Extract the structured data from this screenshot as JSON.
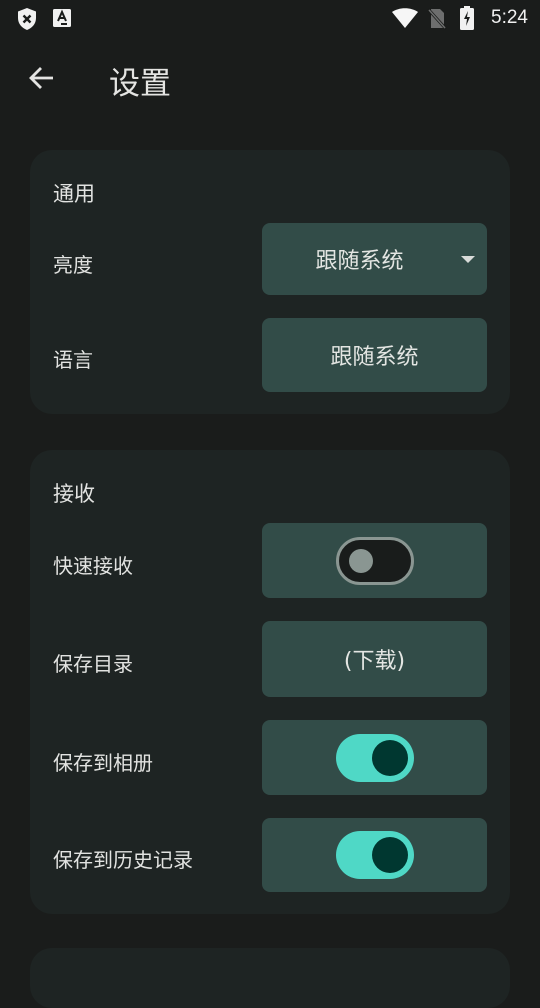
{
  "status_bar": {
    "left_icons": [
      "shield-x-icon",
      "font-a-icon"
    ],
    "right_icons": [
      "wifi-icon",
      "no-sim-icon",
      "battery-charging-icon"
    ],
    "time": "5:24"
  },
  "header": {
    "back_icon": "arrow-back-icon",
    "title": "设置"
  },
  "sections": [
    {
      "title": "通用",
      "rows": [
        {
          "label": "亮度",
          "type": "dropdown",
          "value": "跟随系统"
        },
        {
          "label": "语言",
          "type": "button",
          "value": "跟随系统"
        }
      ]
    },
    {
      "title": "接收",
      "rows": [
        {
          "label": "快速接收",
          "type": "toggle",
          "checked": false
        },
        {
          "label": "保存目录",
          "type": "button",
          "value": "(下载)"
        },
        {
          "label": "保存到相册",
          "type": "toggle",
          "checked": true
        },
        {
          "label": "保存到历史记录",
          "type": "toggle",
          "checked": true
        }
      ]
    }
  ],
  "colors": {
    "background": "#1a1c1b",
    "card": "#1e2423",
    "control": "#324c48",
    "toggle_on_track": "#4fd8c6",
    "toggle_on_thumb": "#003730",
    "toggle_off_outline": "#8a9692"
  }
}
